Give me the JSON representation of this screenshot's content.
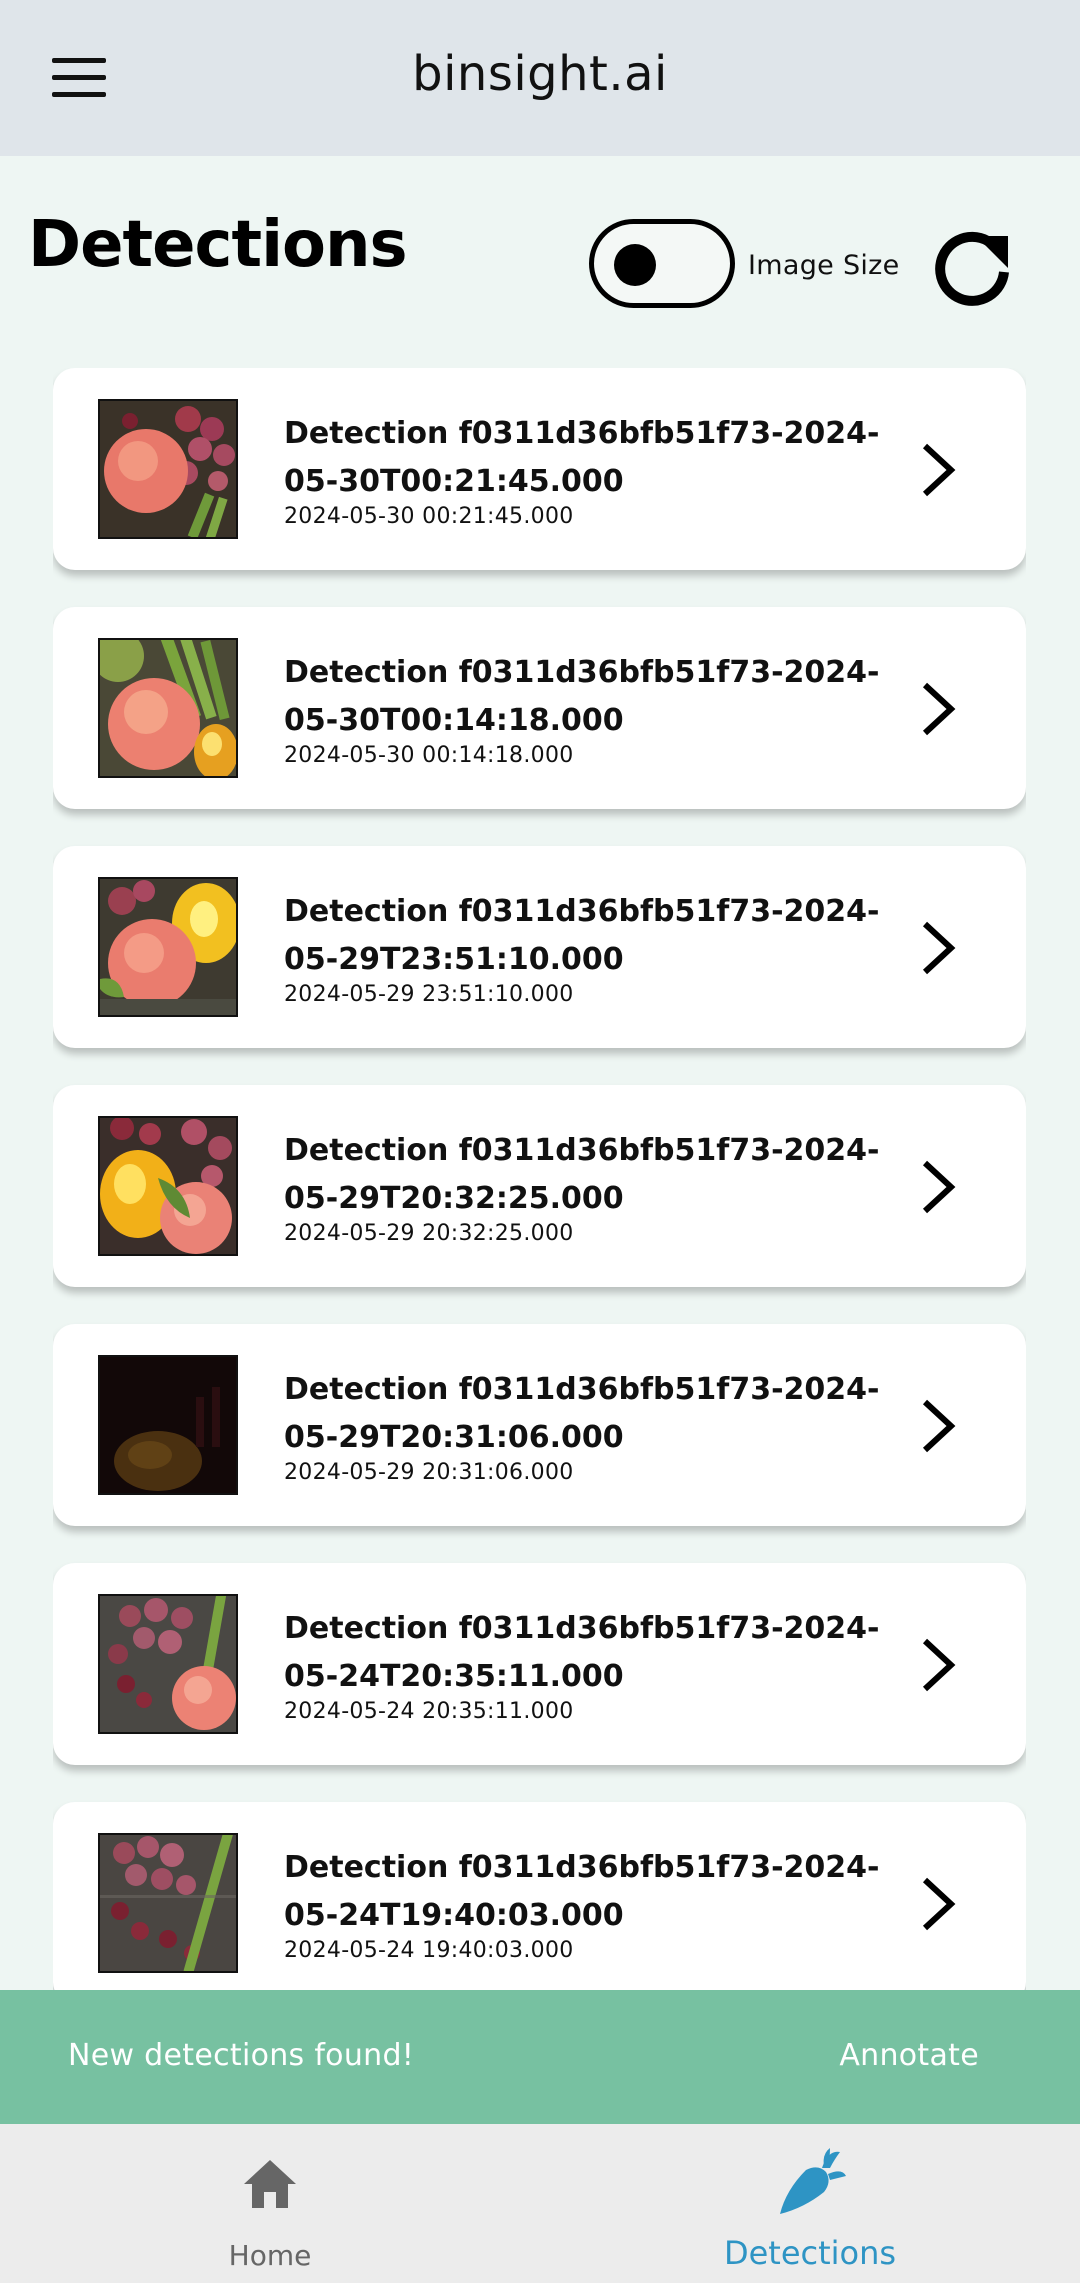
{
  "app": {
    "title": "binsight.ai",
    "menu_icon": "hamburger-menu-icon"
  },
  "page": {
    "title": "Detections",
    "toggle_label": "Image Size",
    "toggle_on": false,
    "refresh_icon": "refresh-icon"
  },
  "detections": [
    {
      "title": "Detection f0311d36bfb51f73-2024-\n05-30T00:21:45.000",
      "timestamp": "2024-05-30 00:21:45.000"
    },
    {
      "title": "Detection f0311d36bfb51f73-2024-\n05-30T00:14:18.000",
      "timestamp": "2024-05-30 00:14:18.000"
    },
    {
      "title": "Detection f0311d36bfb51f73-2024-\n05-29T23:51:10.000",
      "timestamp": "2024-05-29 23:51:10.000"
    },
    {
      "title": "Detection f0311d36bfb51f73-2024-\n05-29T20:32:25.000",
      "timestamp": "2024-05-29 20:32:25.000"
    },
    {
      "title": "Detection f0311d36bfb51f73-2024-\n05-29T20:31:06.000",
      "timestamp": "2024-05-29 20:31:06.000"
    },
    {
      "title": "Detection f0311d36bfb51f73-2024-\n05-24T20:35:11.000",
      "timestamp": "2024-05-24 20:35:11.000"
    },
    {
      "title": "Detection f0311d36bfb51f73-2024-\n05-24T19:40:03.000",
      "timestamp": "2024-05-24 19:40:03.000"
    }
  ],
  "snackbar": {
    "message": "New detections found!",
    "action": "Annotate",
    "color": "#77c1a1"
  },
  "bottom_nav": {
    "items": [
      {
        "label": "Home",
        "icon": "home-icon",
        "active": false
      },
      {
        "label": "Detections",
        "icon": "carrot-icon",
        "active": true
      }
    ],
    "active_color": "#2e94c4"
  }
}
